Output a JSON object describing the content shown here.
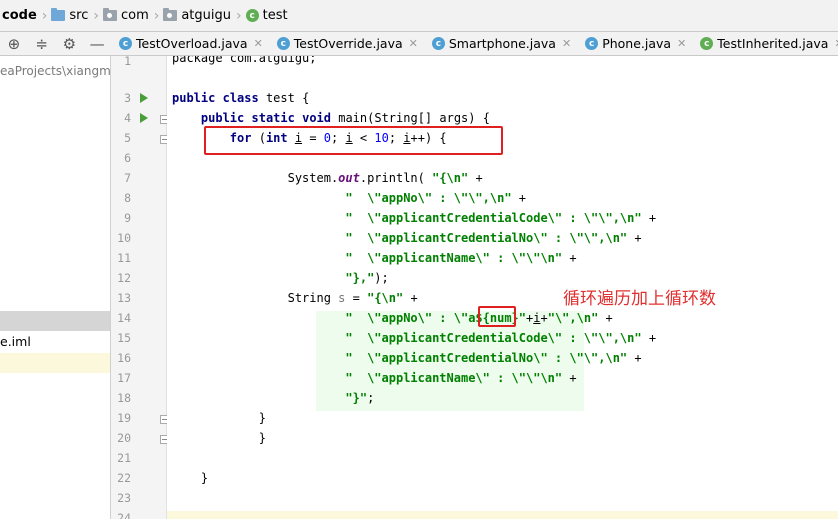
{
  "breadcrumb": [
    {
      "label": "code",
      "icon": "none"
    },
    {
      "label": "src",
      "icon": "source-folder-icon"
    },
    {
      "label": "com",
      "icon": "package-icon"
    },
    {
      "label": "atguigu",
      "icon": "package-icon"
    },
    {
      "label": "test",
      "icon": "class-icon"
    }
  ],
  "tabs": [
    {
      "label": "TestOverload.java"
    },
    {
      "label": "TestOverride.java"
    },
    {
      "label": "Smartphone.java"
    },
    {
      "label": "Phone.java"
    },
    {
      "label": "TestInherited.java"
    }
  ],
  "project_panel": {
    "path": "eaProjects\\xiangmu",
    "file": "e.iml"
  },
  "gutter": {
    "line_numbers": [
      "1",
      "3",
      "4",
      "5",
      "6",
      "7",
      "8",
      "9",
      "10",
      "11",
      "12",
      "13",
      "14",
      "15",
      "16",
      "17",
      "18",
      "19",
      "20",
      "21",
      "22",
      "23",
      "24"
    ]
  },
  "code": {
    "line1": "package com.atguigu;",
    "l3_kw1": "public",
    "l3_kw2": "class",
    "l3_name": " test {",
    "l4_kw1": "public",
    "l4_kw2": "static",
    "l4_kw3": "void",
    "l4_rest": " main(String[] args) {",
    "l5_kw": "for",
    "l5_a": " (",
    "l5_int": "int",
    "l5_b": " ",
    "l5_i1": "i",
    "l5_c": " = ",
    "l5_n0": "0",
    "l5_d": "; ",
    "l5_i2": "i",
    "l5_e": " < ",
    "l5_n10": "10",
    "l5_f": "; ",
    "l5_i3": "i",
    "l5_g": "++) {",
    "l7_a": "System.",
    "l7_out": "out",
    "l7_b": ".println( ",
    "l7_s": "\"{\\n\"",
    "l7_c": " +",
    "l8_s": "\"  \\\"appNo\\\" : \\\"\\\",\\n\"",
    "l8_c": " +",
    "l9_s": "\"  \\\"applicantCredentialCode\\\" : \\\"\\\",\\n\"",
    "l9_c": " +",
    "l10_s": "\"  \\\"applicantCredentialNo\\\" : \\\"\\\",\\n\"",
    "l10_c": " +",
    "l11_s": "\"  \\\"applicantName\\\" : \\\"\\\"\\n\"",
    "l11_c": " +",
    "l12_s": "\"},\"",
    "l12_c": ");",
    "l13_a": "String ",
    "l13_var": "s",
    "l13_b": " = ",
    "l13_s": "\"{\\n\"",
    "l13_c": " +",
    "l14_s1": "\"  \\\"appNo\\\" : \\\"a${num}\"",
    "l14_mid": "+",
    "l14_i": "i",
    "l14_mid2": "+",
    "l14_s2": "\"\\\",\\n\"",
    "l14_c": " +",
    "l15_s": "\"  \\\"applicantCredentialCode\\\" : \\\"\\\",\\n\"",
    "l15_c": " +",
    "l16_s": "\"  \\\"applicantCredentialNo\\\" : \\\"\\\",\\n\"",
    "l16_c": " +",
    "l17_s": "\"  \\\"applicantName\\\" : \\\"\\\"\\n\"",
    "l17_c": " +",
    "l18_s": "\"}\"",
    "l18_c": ";",
    "l19": "}",
    "l20": "}",
    "l22": "}"
  },
  "annotation": {
    "text": "循环遍历加上循环数",
    "color": "#e03030"
  },
  "colors": {
    "keyword": "#000080",
    "string": "#008000",
    "number": "#0000ff",
    "highlight_box": "#e02020"
  }
}
